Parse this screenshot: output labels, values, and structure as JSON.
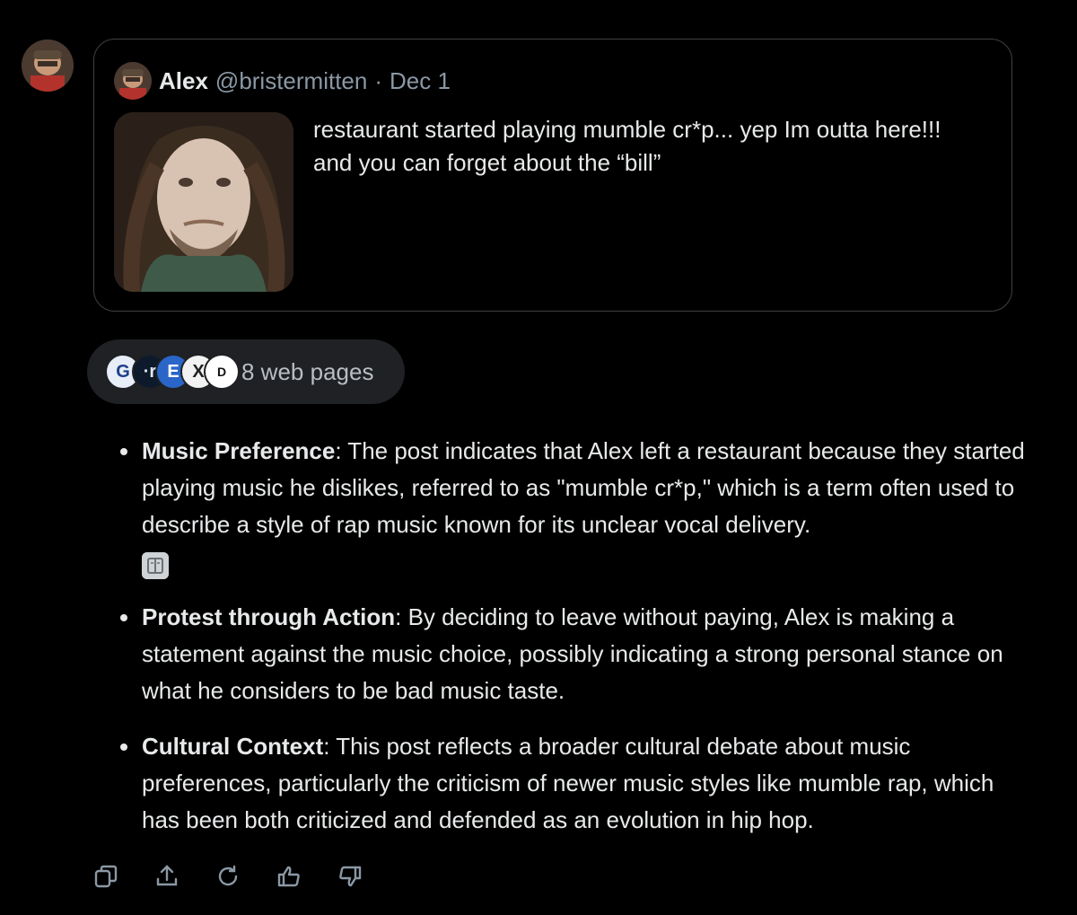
{
  "quoted_post": {
    "name": "Alex",
    "handle": "@bristermitten",
    "separator": "·",
    "date": "Dec 1",
    "text_line1": "restaurant started playing mumble cr*p... yep Im outta here!!!",
    "text_line2": "and you can forget about the “bill”"
  },
  "sources": {
    "label": "8 web pages",
    "favicons": [
      "G",
      "E",
      "X",
      "D"
    ]
  },
  "answer": {
    "items": [
      {
        "title": "Music Preference",
        "body": ": The post indicates that Alex left a restaurant because they started playing music he dislikes, referred to as \"mumble cr*p,\" which is a term often used to describe a style of rap music known for its unclear vocal delivery."
      },
      {
        "title": "Protest through Action",
        "body": ": By deciding to leave without paying, Alex is making a statement against the music choice, possibly indicating a strong personal stance on what he considers to be bad music taste."
      },
      {
        "title": "Cultural Context",
        "body": ": This post reflects a broader cultural debate about music preferences, particularly the criticism of newer music styles like mumble rap, which has been both criticized and defended as an evolution in hip hop."
      }
    ]
  },
  "actions": [
    "copy-icon",
    "share-icon",
    "regenerate-icon",
    "thumbs-up-icon",
    "thumbs-down-icon"
  ],
  "colors": {
    "background": "#000000",
    "text": "#e7e9ea",
    "muted": "#8b98a5",
    "pill": "#1f2124",
    "border": "#3e4144"
  }
}
